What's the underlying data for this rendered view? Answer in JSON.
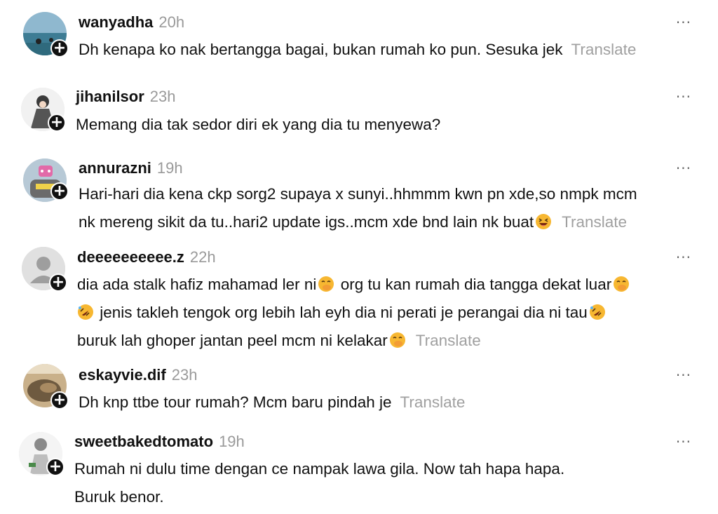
{
  "comments": [
    {
      "username": "wanyadha",
      "time": "20h",
      "lines": [
        "Dh kenapa ko nak bertangga bagai, bukan rumah ko pun. Sesuka jek"
      ],
      "translate": "Translate"
    },
    {
      "username": "jihanilsor",
      "time": "23h",
      "lines": [
        "Memang dia tak sedor diri ek yang dia tu menyewa?"
      ]
    },
    {
      "username": "annurazni",
      "time": "19h",
      "lines": [
        "Hari-hari dia kena ckp sorg2 supaya x sunyi..hhmmm kwn pn xde,so nmpk mcm",
        "nk mereng sikit da tu..hari2 update igs..mcm xde bnd lain nk buat"
      ],
      "translate": "Translate"
    },
    {
      "username": "deeeeeeeeee.z",
      "time": "22h",
      "lines": [
        "dia ada stalk hafiz mahamad ler ni",
        "org tu kan rumah dia tangga dekat luar",
        "jenis takleh tengok org lebih lah eyh dia ni perati je perangai dia ni tau",
        "buruk lah ghoper jantan peel mcm ni kelakar"
      ],
      "translate": "Translate"
    },
    {
      "username": "eskayvie.dif",
      "time": "23h",
      "lines": [
        "Dh knp ttbe tour rumah? Mcm baru pindah je"
      ],
      "translate": "Translate"
    },
    {
      "username": "sweetbakedtomato",
      "time": "19h",
      "lines": [
        "Rumah ni dulu time dengan ce nampak lawa gila. Now tah hapa hapa.",
        "Buruk benor."
      ]
    }
  ],
  "icons": {
    "more": "more-options-icon",
    "follow": "plus-icon",
    "emojis": [
      "laughing-squint-face",
      "hand-over-mouth-face",
      "rolling-on-floor-laughing-face"
    ]
  },
  "more_glyph": "···",
  "follow_glyph": "+",
  "colors": {
    "text": "#111111",
    "muted": "#9a9a9a",
    "emoji": "#f7b731"
  }
}
